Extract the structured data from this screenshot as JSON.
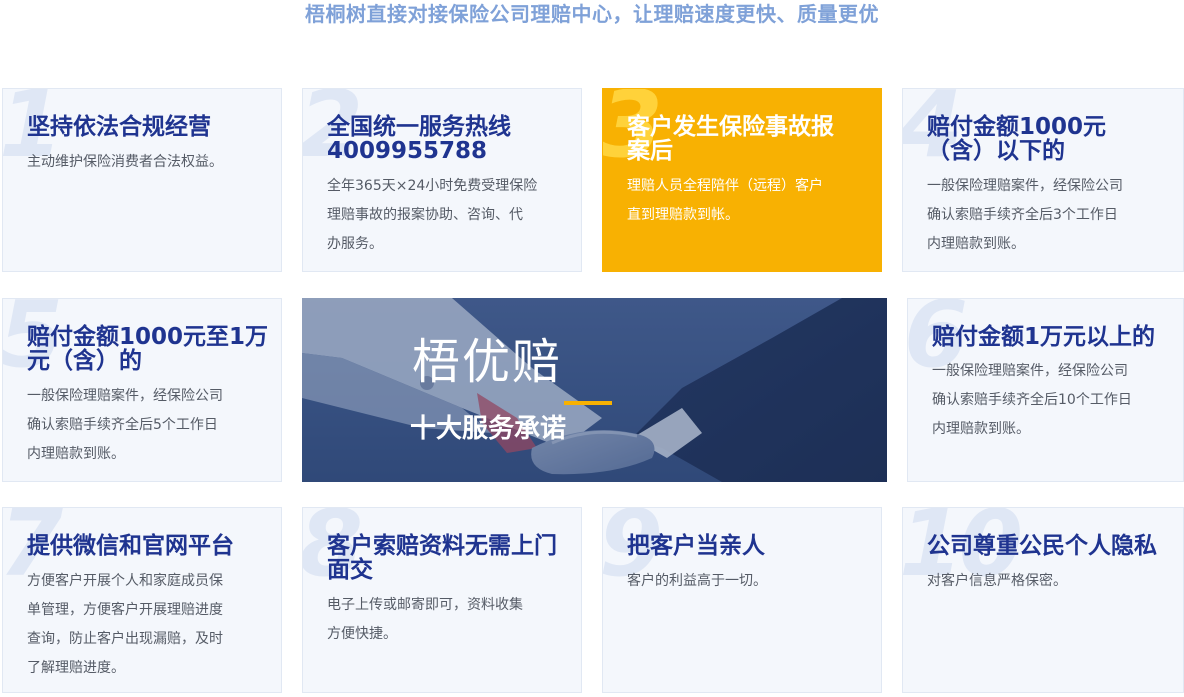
{
  "headline": "梧桐树直接对接保险公司理赔中心，让理赔速度更快、质量更优",
  "cards": [
    {
      "num": "1",
      "title": "坚持依法合规经营",
      "desc": "主动维护保险消费者合法权益。"
    },
    {
      "num": "2",
      "title": "全国统一服务热线\n4009955788",
      "desc": "全年365天×24小时免费受理保险\n理赔事故的报案协助、咨询、代\n办服务。"
    },
    {
      "num": "3",
      "title": "客户发生保险事故报\n案后",
      "desc": "理赔人员全程陪伴（远程）客户\n直到理赔款到帐。"
    },
    {
      "num": "4",
      "title": "赔付金额1000元\n（含）以下的",
      "desc": "一般保险理赔案件，经保险公司\n确认索赔手续齐全后3个工作日\n内理赔款到账。"
    },
    {
      "num": "5",
      "title": "赔付金额1000元至1万\n元（含）的",
      "desc": "一般保险理赔案件，经保险公司\n确认索赔手续齐全后5个工作日\n内理赔款到账。"
    },
    {
      "num": "6",
      "title": "赔付金额1万元以上的",
      "desc": "一般保险理赔案件，经保险公司\n确认索赔手续齐全后10个工作日\n内理赔款到账。"
    },
    {
      "num": "7",
      "title": "提供微信和官网平台",
      "desc": "方便客户开展个人和家庭成员保\n单管理，方便客户开展理赔进度\n查询，防止客户出现漏赔，及时\n了解理赔进度。"
    },
    {
      "num": "8",
      "title": "客户索赔资料无需上门\n面交",
      "desc": "电子上传或邮寄即可，资料收集\n方便快捷。"
    },
    {
      "num": "9",
      "title": "把客户当亲人",
      "desc": "客户的利益高于一切。"
    },
    {
      "num": "10",
      "title": "公司尊重公民个人隐私",
      "desc": "对客户信息严格保密。"
    }
  ],
  "banner": {
    "title": "梧优赔",
    "subtitle": "十大服务承诺"
  },
  "colors": {
    "title": "#1f3490",
    "highlight": "#f8b102",
    "headline": "#7fa1d8"
  }
}
